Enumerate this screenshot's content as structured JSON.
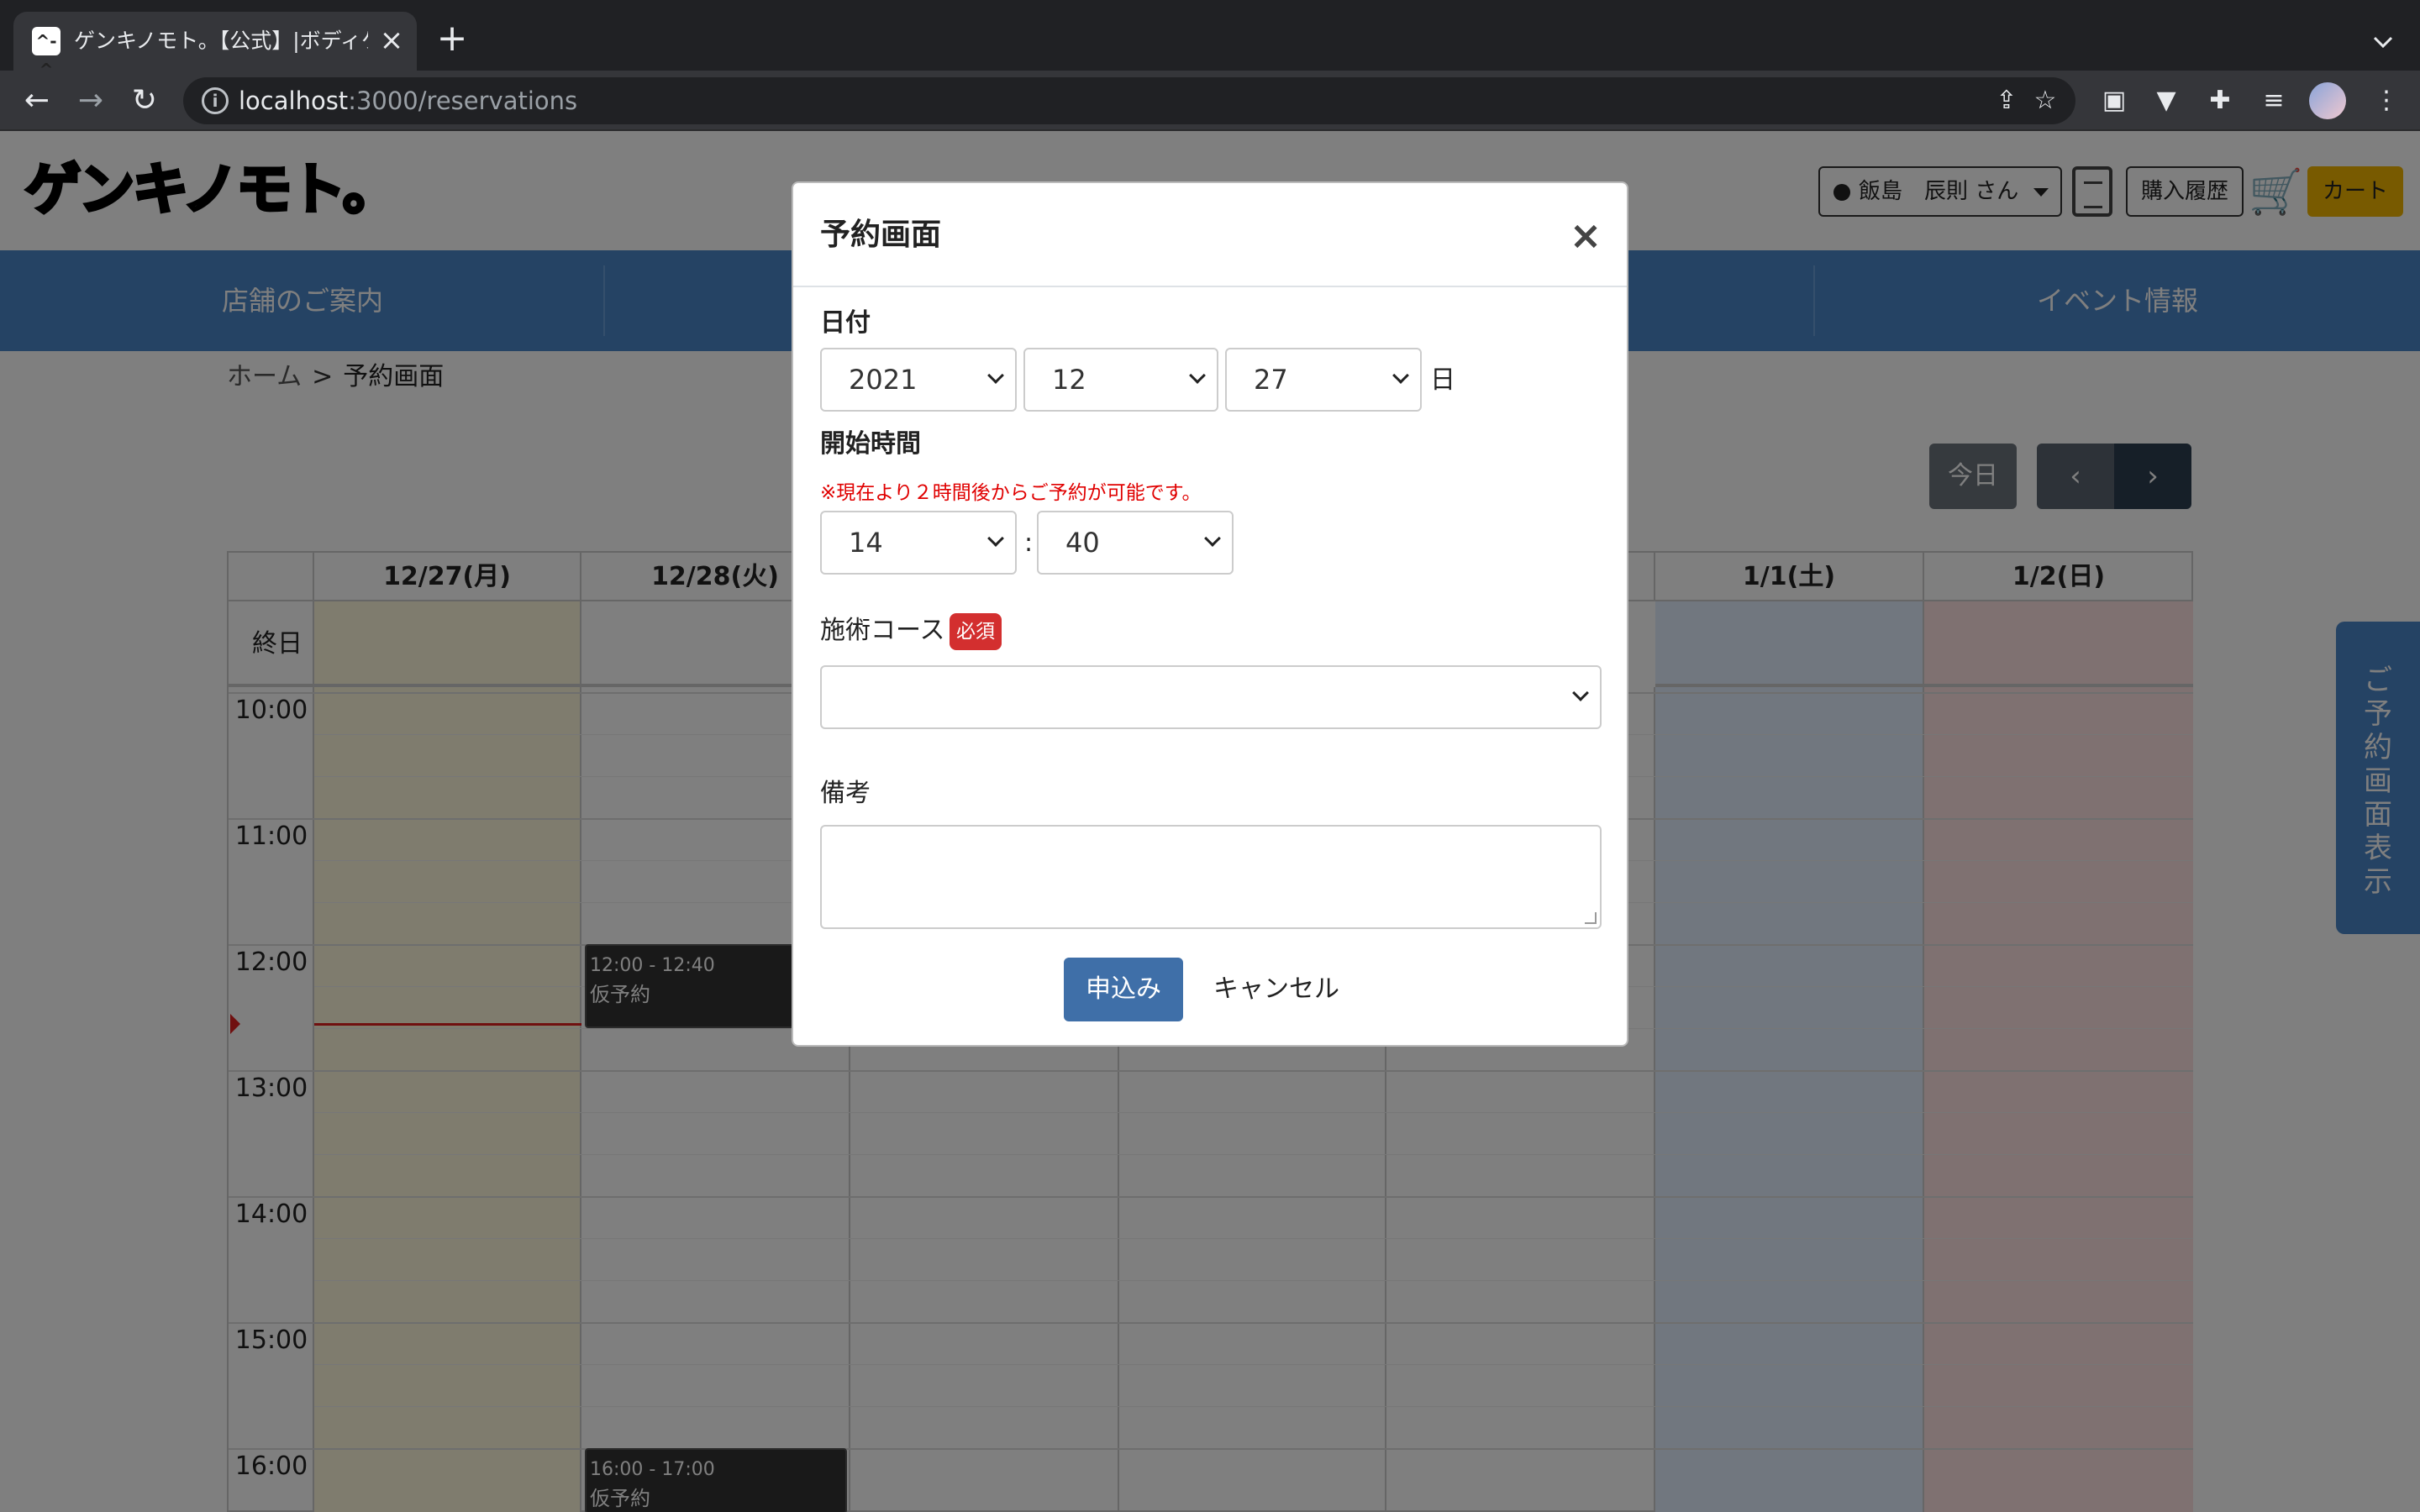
{
  "browser": {
    "tab_title": "ゲンキノモト。【公式】|ボディケア",
    "favicon_glyph": "^-^",
    "url_host": "localhost",
    "url_path": ":3000/reservations"
  },
  "site": {
    "logo_text": "ゲンキノモト。",
    "user_name": "飯島　辰則 さん",
    "history_label": "購入履歴",
    "cart_label": "カート",
    "accent_color": "#4a86c8",
    "cart_color": "#f0b400",
    "nav": {
      "store_info": "店舗のご案内",
      "event_info": "イベント情報"
    },
    "breadcrumb": {
      "home": "ホーム",
      "separator": ">",
      "current": "予約画面"
    },
    "calendar_controls": {
      "today": "今日",
      "prev": "‹",
      "next": "›"
    },
    "calendar": {
      "days": [
        "12/27(月)",
        "12/28(火)",
        "",
        "",
        "",
        "1/1(土)",
        "1/2(日)"
      ],
      "allday_label": "終日",
      "hours": [
        "10:00",
        "11:00",
        "12:00",
        "13:00",
        "14:00",
        "15:00",
        "16:00"
      ],
      "events": [
        {
          "time": "12:00 - 12:40",
          "label": "仮予約"
        },
        {
          "time": "16:00 - 17:00",
          "label": "仮予約"
        }
      ]
    },
    "side_tab_label": "ご予約画面表示"
  },
  "modal": {
    "title": "予約画面",
    "close": "×",
    "date_label": "日付",
    "year": "2021",
    "month": "12",
    "day": "27",
    "day_unit": "日",
    "start_time_label": "開始時間",
    "note": "※現在より２時間後からご予約が可能です。",
    "hour": "14",
    "time_separator": ":",
    "minute": "40",
    "course_label": "施術コース",
    "required_badge": "必須",
    "course_value": "",
    "remarks_label": "備考",
    "remarks_value": "",
    "submit_label": "申込み",
    "cancel_label": "キャンセル",
    "required_color": "#d32f2f",
    "note_color": "#e00000"
  }
}
